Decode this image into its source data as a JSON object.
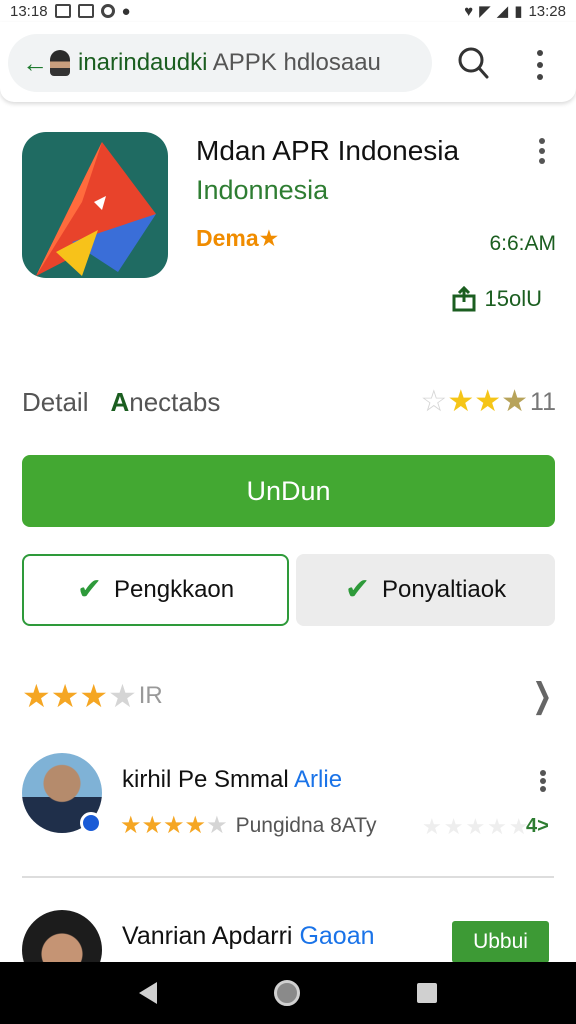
{
  "status_bar": {
    "time": "13:18",
    "right_text": "13:28"
  },
  "address_bar": {
    "domain_text": "inarindaudki",
    "rest_text": " APPK hdlosaau"
  },
  "app": {
    "title": "Mdan APR Indonesia",
    "developer": "Indonnesia",
    "badge": "Dema★",
    "time": "6:6:AM",
    "size": "15olU"
  },
  "tabs": {
    "detail": "Detail",
    "notes_glyph": "A",
    "notes_rest": "nectabs"
  },
  "top_rating": {
    "value": 3.5,
    "count": "11"
  },
  "buttons": {
    "download": "UnDun",
    "outline": "Pengkkaon",
    "grey": "Ponyaltiaok"
  },
  "rating_summary": {
    "stars": 3,
    "label": "IR"
  },
  "reviews": [
    {
      "name": "kirhil Pe Smmal",
      "tag": "Arlie",
      "stars": 4,
      "meta": "Pungidna 8ATy",
      "action": "4>"
    },
    {
      "name": "Vanrian Apdarri",
      "tag": "Gaoan",
      "follow": "Ubbui"
    }
  ],
  "icons": {
    "back": "back-arrow-icon",
    "search": "search-icon",
    "menu": "more-vert-icon",
    "share": "share-icon",
    "check": "check-icon",
    "chevron": "chevron-right-icon"
  },
  "colors": {
    "primary_green": "#43a832",
    "dark_green": "#1b5e20",
    "star": "#f5c518",
    "badge_orange": "#f08c00",
    "link_blue": "#1a73e8"
  }
}
